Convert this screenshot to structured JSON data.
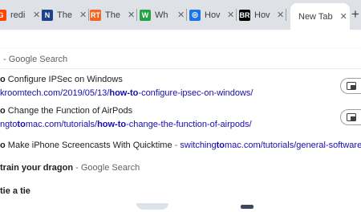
{
  "tabs": [
    {
      "icon": "reddit-icon",
      "title": "redi",
      "color": "#ff4500",
      "glyph": "G"
    },
    {
      "icon": "nba-icon",
      "title": "The",
      "color": "#1d428a",
      "glyph": "N"
    },
    {
      "icon": "rtt-icon",
      "title": "The",
      "color": "#f26522",
      "glyph": "RT"
    },
    {
      "icon": "whatsapp-icon",
      "title": "Wh",
      "color": "#25a244",
      "glyph": "W"
    },
    {
      "icon": "globe-icon",
      "title": "Hov",
      "color": "#1a73e8",
      "glyph": "◎"
    },
    {
      "icon": "br-icon",
      "title": "Hov",
      "color": "#000000",
      "glyph": "BR"
    }
  ],
  "active_tab": {
    "title": "New Tab"
  },
  "omnibox": {
    "text": "- Google Search"
  },
  "suggestions": [
    {
      "title_prefix": "o",
      "title_rest": " Configure IPSec on Windows",
      "url_pre": "kroomtech.com/2019/05/13/",
      "url_bold": "how-to",
      "url_post": "-configure-ipsec-on-windows/"
    },
    {
      "title_prefix": "o",
      "title_rest": " Change the Function of AirPods",
      "url_pre": "ngto",
      "url_bold": "mac.com/tutorials/how-to",
      "url_post": "-change-the-function-of-airpods/",
      "url_lead": "ngto"
    }
  ],
  "inline_suggestion": {
    "prefix": "o",
    "title": " Make iPhone Screencasts With Quicktime",
    "dash": " - ",
    "url_pre": "switching",
    "url_bold": "to",
    "url_post": "mac.com/tutorials/general-software/ho"
  },
  "query1": {
    "bold": "train your dragon",
    "suffix": " - Google Search"
  },
  "query2": {
    "bold": "tie a tie"
  },
  "tab_switch": {
    "label": "Switch to this tab"
  }
}
